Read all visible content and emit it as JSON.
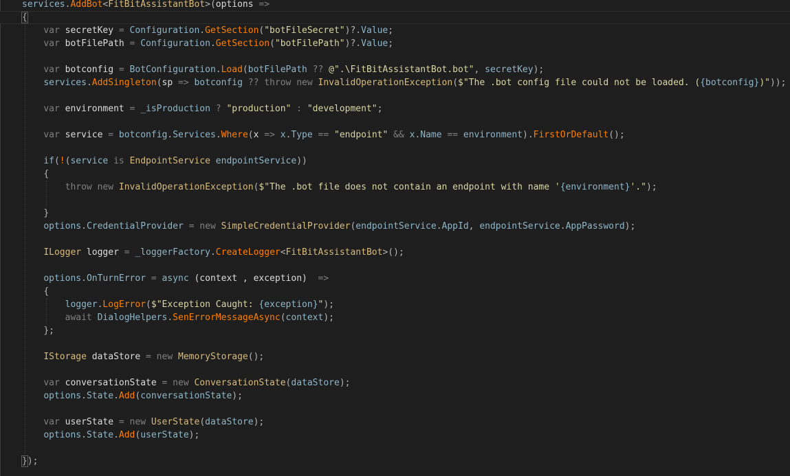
{
  "editor": {
    "lines": [
      [
        {
          "t": "services",
          "c": "prop"
        },
        {
          "t": ".",
          "c": "pn"
        },
        {
          "t": "AddBot",
          "c": "mth"
        },
        {
          "t": "<",
          "c": "pn"
        },
        {
          "t": "FitBitAssistantBot",
          "c": "cls"
        },
        {
          "t": ">(",
          "c": "pn"
        },
        {
          "t": "options",
          "c": "var"
        },
        {
          "t": " =>",
          "c": "op"
        }
      ],
      [
        {
          "t": "{",
          "c": "brace"
        }
      ],
      [
        {
          "t": "    "
        },
        {
          "t": "var",
          "c": "kw2"
        },
        {
          "t": " secretKey ",
          "c": "var"
        },
        {
          "t": "=",
          "c": "op"
        },
        {
          "t": " Configuration",
          "c": "prop"
        },
        {
          "t": ".",
          "c": "pn"
        },
        {
          "t": "GetSection",
          "c": "mth"
        },
        {
          "t": "(",
          "c": "pn"
        },
        {
          "t": "\"botFileSecret\"",
          "c": "strg"
        },
        {
          "t": ")?.",
          "c": "pn"
        },
        {
          "t": "Value",
          "c": "prop"
        },
        {
          "t": ";",
          "c": "pn"
        }
      ],
      [
        {
          "t": "    "
        },
        {
          "t": "var",
          "c": "kw2"
        },
        {
          "t": " botFilePath ",
          "c": "var"
        },
        {
          "t": "=",
          "c": "op"
        },
        {
          "t": " Configuration",
          "c": "prop"
        },
        {
          "t": ".",
          "c": "pn"
        },
        {
          "t": "GetSection",
          "c": "mth"
        },
        {
          "t": "(",
          "c": "pn"
        },
        {
          "t": "\"botFilePath\"",
          "c": "strg"
        },
        {
          "t": ")?.",
          "c": "pn"
        },
        {
          "t": "Value",
          "c": "prop"
        },
        {
          "t": ";",
          "c": "pn"
        }
      ],
      [],
      [
        {
          "t": "    "
        },
        {
          "t": "var",
          "c": "kw2"
        },
        {
          "t": " botconfig ",
          "c": "var"
        },
        {
          "t": "=",
          "c": "op"
        },
        {
          "t": " BotConfiguration",
          "c": "prop"
        },
        {
          "t": ".",
          "c": "pn"
        },
        {
          "t": "Load",
          "c": "mth"
        },
        {
          "t": "(",
          "c": "pn"
        },
        {
          "t": "botFilePath",
          "c": "prop"
        },
        {
          "t": " ?? ",
          "c": "op"
        },
        {
          "t": "@\".\\FitBitAssistantBot.bot\"",
          "c": "strg"
        },
        {
          "t": ", ",
          "c": "pn"
        },
        {
          "t": "secretKey",
          "c": "prop"
        },
        {
          "t": ");",
          "c": "pn"
        }
      ],
      [
        {
          "t": "    "
        },
        {
          "t": "services",
          "c": "prop"
        },
        {
          "t": ".",
          "c": "pn"
        },
        {
          "t": "AddSingleton",
          "c": "mth"
        },
        {
          "t": "(",
          "c": "pn"
        },
        {
          "t": "sp",
          "c": "var"
        },
        {
          "t": " => ",
          "c": "op"
        },
        {
          "t": "botconfig",
          "c": "prop"
        },
        {
          "t": " ?? ",
          "c": "op"
        },
        {
          "t": "throw",
          "c": "kw2"
        },
        {
          "t": " new ",
          "c": "kw2"
        },
        {
          "t": "InvalidOperationException",
          "c": "cls"
        },
        {
          "t": "(",
          "c": "pn"
        },
        {
          "t": "$\"The .bot config file could not be loaded. (",
          "c": "strg"
        },
        {
          "t": "{botconfig}",
          "c": "prop"
        },
        {
          "t": ")\"",
          "c": "strg"
        },
        {
          "t": "));",
          "c": "pn"
        }
      ],
      [],
      [
        {
          "t": "    "
        },
        {
          "t": "var",
          "c": "kw2"
        },
        {
          "t": " environment ",
          "c": "var"
        },
        {
          "t": "=",
          "c": "op"
        },
        {
          "t": " _isProduction",
          "c": "prop"
        },
        {
          "t": " ? ",
          "c": "op"
        },
        {
          "t": "\"production\"",
          "c": "strg"
        },
        {
          "t": " : ",
          "c": "op"
        },
        {
          "t": "\"development\"",
          "c": "strg"
        },
        {
          "t": ";",
          "c": "pn"
        }
      ],
      [],
      [
        {
          "t": "    "
        },
        {
          "t": "var",
          "c": "kw2"
        },
        {
          "t": " service ",
          "c": "var"
        },
        {
          "t": "=",
          "c": "op"
        },
        {
          "t": " botconfig",
          "c": "prop"
        },
        {
          "t": ".",
          "c": "pn"
        },
        {
          "t": "Services",
          "c": "prop"
        },
        {
          "t": ".",
          "c": "pn"
        },
        {
          "t": "Where",
          "c": "mth"
        },
        {
          "t": "(",
          "c": "pn"
        },
        {
          "t": "x",
          "c": "var"
        },
        {
          "t": " => ",
          "c": "op"
        },
        {
          "t": "x",
          "c": "prop"
        },
        {
          "t": ".",
          "c": "pn"
        },
        {
          "t": "Type",
          "c": "prop"
        },
        {
          "t": " == ",
          "c": "op"
        },
        {
          "t": "\"endpoint\"",
          "c": "strg"
        },
        {
          "t": " && ",
          "c": "op"
        },
        {
          "t": "x",
          "c": "prop"
        },
        {
          "t": ".",
          "c": "pn"
        },
        {
          "t": "Name",
          "c": "prop"
        },
        {
          "t": " == ",
          "c": "op"
        },
        {
          "t": "environment",
          "c": "prop"
        },
        {
          "t": ").",
          "c": "pn"
        },
        {
          "t": "FirstOrDefault",
          "c": "mth"
        },
        {
          "t": "();",
          "c": "pn"
        }
      ],
      [],
      [
        {
          "t": "    "
        },
        {
          "t": "if",
          "c": "prop"
        },
        {
          "t": "(",
          "c": "pn"
        },
        {
          "t": "!",
          "c": "mth"
        },
        {
          "t": "(",
          "c": "pn"
        },
        {
          "t": "service",
          "c": "prop"
        },
        {
          "t": " is ",
          "c": "kw2"
        },
        {
          "t": "EndpointService",
          "c": "cls"
        },
        {
          "t": " endpointService",
          "c": "prop"
        },
        {
          "t": "))",
          "c": "pn"
        }
      ],
      [
        {
          "t": "    "
        },
        {
          "t": "{",
          "c": "pn"
        }
      ],
      [
        {
          "t": "        "
        },
        {
          "t": "throw",
          "c": "kw2"
        },
        {
          "t": " new ",
          "c": "kw2"
        },
        {
          "t": "InvalidOperationException",
          "c": "cls"
        },
        {
          "t": "(",
          "c": "pn"
        },
        {
          "t": "$\"The .bot file does not contain an endpoint with name '",
          "c": "strg"
        },
        {
          "t": "{environment}",
          "c": "prop"
        },
        {
          "t": "'.\"",
          "c": "strg"
        },
        {
          "t": ");",
          "c": "pn"
        }
      ],
      [],
      [
        {
          "t": "    "
        },
        {
          "t": "}",
          "c": "pn"
        }
      ],
      [
        {
          "t": "    "
        },
        {
          "t": "options",
          "c": "prop"
        },
        {
          "t": ".",
          "c": "pn"
        },
        {
          "t": "CredentialProvider",
          "c": "prop"
        },
        {
          "t": " = ",
          "c": "op"
        },
        {
          "t": "new ",
          "c": "kw2"
        },
        {
          "t": "SimpleCredentialProvider",
          "c": "cls"
        },
        {
          "t": "(",
          "c": "pn"
        },
        {
          "t": "endpointService",
          "c": "prop"
        },
        {
          "t": ".",
          "c": "pn"
        },
        {
          "t": "AppId",
          "c": "prop"
        },
        {
          "t": ", ",
          "c": "pn"
        },
        {
          "t": "endpointService",
          "c": "prop"
        },
        {
          "t": ".",
          "c": "pn"
        },
        {
          "t": "AppPassword",
          "c": "prop"
        },
        {
          "t": ");",
          "c": "pn"
        }
      ],
      [],
      [
        {
          "t": "    "
        },
        {
          "t": "ILogger",
          "c": "cls"
        },
        {
          "t": " logger ",
          "c": "var"
        },
        {
          "t": "=",
          "c": "op"
        },
        {
          "t": " _loggerFactory",
          "c": "prop"
        },
        {
          "t": ".",
          "c": "pn"
        },
        {
          "t": "CreateLogger",
          "c": "mth"
        },
        {
          "t": "<",
          "c": "pn"
        },
        {
          "t": "FitBitAssistantBot",
          "c": "cls"
        },
        {
          "t": ">();",
          "c": "pn"
        }
      ],
      [],
      [
        {
          "t": "    "
        },
        {
          "t": "options",
          "c": "prop"
        },
        {
          "t": ".",
          "c": "pn"
        },
        {
          "t": "OnTurnError",
          "c": "prop"
        },
        {
          "t": " = ",
          "c": "op"
        },
        {
          "t": "async",
          "c": "prop"
        },
        {
          "t": " (context , exception)  ",
          "c": "var"
        },
        {
          "t": "=>",
          "c": "op"
        }
      ],
      [
        {
          "t": "    "
        },
        {
          "t": "{",
          "c": "pn"
        }
      ],
      [
        {
          "t": "        "
        },
        {
          "t": "logger",
          "c": "prop"
        },
        {
          "t": ".",
          "c": "pn"
        },
        {
          "t": "LogError",
          "c": "mth"
        },
        {
          "t": "(",
          "c": "pn"
        },
        {
          "t": "$\"Exception Caught: ",
          "c": "strg"
        },
        {
          "t": "{exception}",
          "c": "prop"
        },
        {
          "t": "\"",
          "c": "strg"
        },
        {
          "t": ");",
          "c": "pn"
        }
      ],
      [
        {
          "t": "        "
        },
        {
          "t": "await",
          "c": "kw2"
        },
        {
          "t": " DialogHelpers",
          "c": "prop"
        },
        {
          "t": ".",
          "c": "pn"
        },
        {
          "t": "SenErrorMessageAsync",
          "c": "mth"
        },
        {
          "t": "(",
          "c": "pn"
        },
        {
          "t": "context",
          "c": "prop"
        },
        {
          "t": ");",
          "c": "pn"
        }
      ],
      [
        {
          "t": "    "
        },
        {
          "t": "};",
          "c": "pn"
        }
      ],
      [],
      [
        {
          "t": "    "
        },
        {
          "t": "IStorage",
          "c": "cls"
        },
        {
          "t": " dataStore ",
          "c": "var"
        },
        {
          "t": "=",
          "c": "op"
        },
        {
          "t": " new ",
          "c": "kw2"
        },
        {
          "t": "MemoryStorage",
          "c": "cls"
        },
        {
          "t": "();",
          "c": "pn"
        }
      ],
      [],
      [
        {
          "t": "    "
        },
        {
          "t": "var",
          "c": "kw2"
        },
        {
          "t": " conversationState ",
          "c": "var"
        },
        {
          "t": "=",
          "c": "op"
        },
        {
          "t": " new ",
          "c": "kw2"
        },
        {
          "t": "ConversationState",
          "c": "cls"
        },
        {
          "t": "(",
          "c": "pn"
        },
        {
          "t": "dataStore",
          "c": "prop"
        },
        {
          "t": ");",
          "c": "pn"
        }
      ],
      [
        {
          "t": "    "
        },
        {
          "t": "options",
          "c": "prop"
        },
        {
          "t": ".",
          "c": "pn"
        },
        {
          "t": "State",
          "c": "prop"
        },
        {
          "t": ".",
          "c": "pn"
        },
        {
          "t": "Add",
          "c": "mth"
        },
        {
          "t": "(",
          "c": "pn"
        },
        {
          "t": "conversationState",
          "c": "prop"
        },
        {
          "t": ");",
          "c": "pn"
        }
      ],
      [],
      [
        {
          "t": "    "
        },
        {
          "t": "var",
          "c": "kw2"
        },
        {
          "t": " userState ",
          "c": "var"
        },
        {
          "t": "=",
          "c": "op"
        },
        {
          "t": " new ",
          "c": "kw2"
        },
        {
          "t": "UserState",
          "c": "cls"
        },
        {
          "t": "(",
          "c": "pn"
        },
        {
          "t": "dataStore",
          "c": "prop"
        },
        {
          "t": ");",
          "c": "pn"
        }
      ],
      [
        {
          "t": "    "
        },
        {
          "t": "options",
          "c": "prop"
        },
        {
          "t": ".",
          "c": "pn"
        },
        {
          "t": "State",
          "c": "prop"
        },
        {
          "t": ".",
          "c": "pn"
        },
        {
          "t": "Add",
          "c": "mth"
        },
        {
          "t": "(",
          "c": "pn"
        },
        {
          "t": "userState",
          "c": "prop"
        },
        {
          "t": ");",
          "c": "pn"
        }
      ],
      [],
      [
        {
          "t": "}",
          "c": "brace"
        },
        {
          "t": ");",
          "c": "pn"
        }
      ]
    ]
  },
  "colors": {
    "background": "#1e1e1e",
    "keyword": "#808080",
    "type": "#d7ba7d",
    "method": "#ff8000",
    "identifier": "#8fb6c9",
    "string": "#d7d7a3",
    "plain": "#dcdcdc"
  }
}
